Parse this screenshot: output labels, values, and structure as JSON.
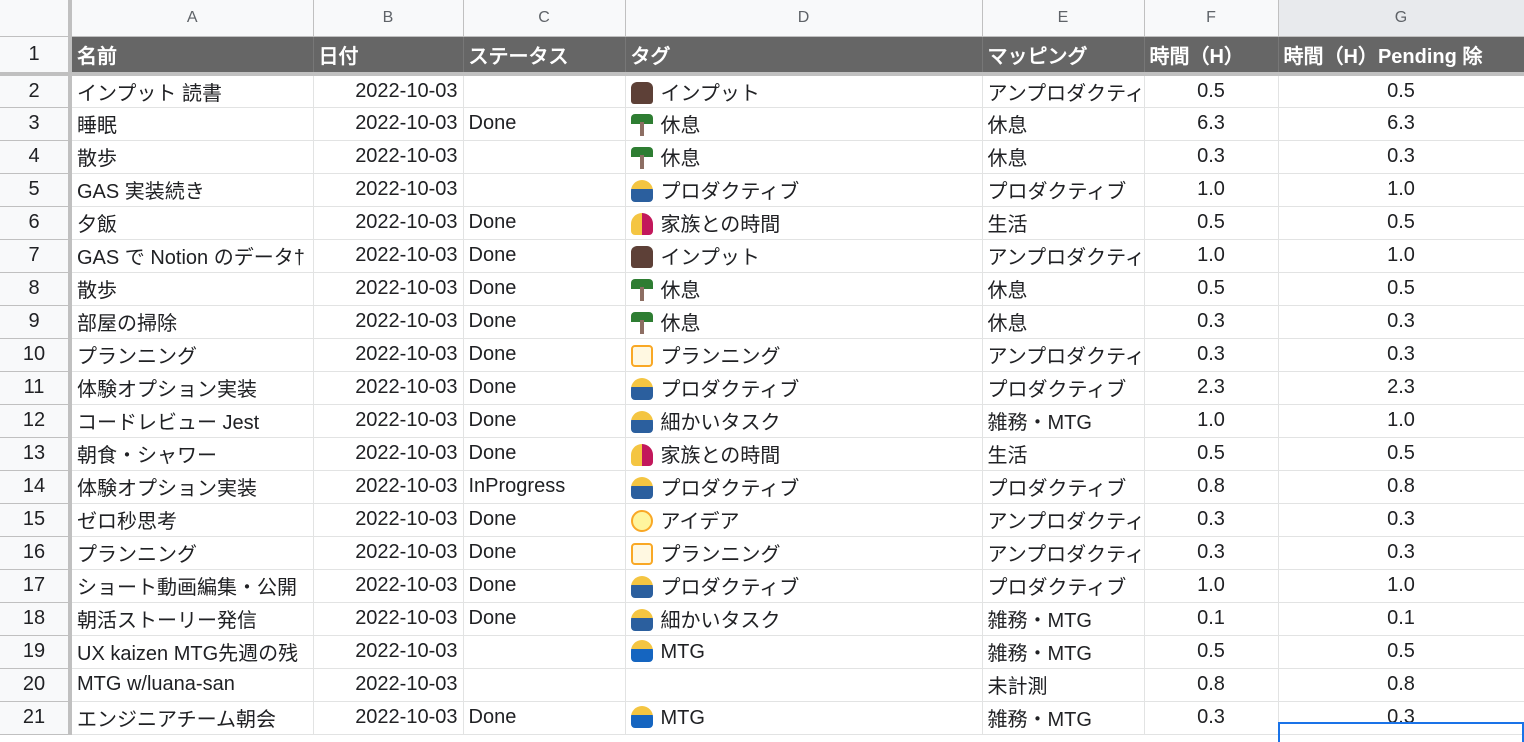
{
  "columns": [
    "A",
    "B",
    "C",
    "D",
    "E",
    "F",
    "G"
  ],
  "header": {
    "row_number": "1",
    "cells": [
      "名前",
      "日付",
      "ステータス",
      "タグ",
      "マッピング",
      "時間（H）",
      "時間（H）Pending 除"
    ]
  },
  "rows": [
    {
      "n": "2",
      "name": "インプット 読書",
      "date": "2022-10-03",
      "status": "",
      "tag": "インプット",
      "tag_icon": "elephant-icon",
      "mapping": "アンプロダクティブ",
      "hours": "0.5",
      "hours_excl": "0.5"
    },
    {
      "n": "3",
      "name": "睡眠",
      "date": "2022-10-03",
      "status": "Done",
      "tag": "休息",
      "tag_icon": "palm-tree-icon",
      "mapping": "休息",
      "hours": "6.3",
      "hours_excl": "6.3"
    },
    {
      "n": "4",
      "name": "散歩",
      "date": "2022-10-03",
      "status": "",
      "tag": "休息",
      "tag_icon": "palm-tree-icon",
      "mapping": "休息",
      "hours": "0.3",
      "hours_excl": "0.3"
    },
    {
      "n": "5",
      "name": "GAS 実装続き",
      "date": "2022-10-03",
      "status": "",
      "tag": "プロダクティブ",
      "tag_icon": "technologist-icon",
      "mapping": "プロダクティブ",
      "hours": "1.0",
      "hours_excl": "1.0"
    },
    {
      "n": "6",
      "name": "夕飯",
      "date": "2022-10-03",
      "status": "Done",
      "tag": "家族との時間",
      "tag_icon": "family-icon",
      "mapping": "生活",
      "hours": "0.5",
      "hours_excl": "0.5"
    },
    {
      "n": "7",
      "name": "GAS で Notion のデータ†",
      "date": "2022-10-03",
      "status": "Done",
      "tag": "インプット",
      "tag_icon": "elephant-icon",
      "mapping": "アンプロダクティブ",
      "hours": "1.0",
      "hours_excl": "1.0"
    },
    {
      "n": "8",
      "name": "散歩",
      "date": "2022-10-03",
      "status": "Done",
      "tag": "休息",
      "tag_icon": "palm-tree-icon",
      "mapping": "休息",
      "hours": "0.5",
      "hours_excl": "0.5"
    },
    {
      "n": "9",
      "name": "部屋の掃除",
      "date": "2022-10-03",
      "status": "Done",
      "tag": "休息",
      "tag_icon": "palm-tree-icon",
      "mapping": "休息",
      "hours": "0.3",
      "hours_excl": "0.3"
    },
    {
      "n": "10",
      "name": "プランニング",
      "date": "2022-10-03",
      "status": "Done",
      "tag": "プランニング",
      "tag_icon": "memo-icon",
      "mapping": "アンプロダクティブ",
      "hours": "0.3",
      "hours_excl": "0.3"
    },
    {
      "n": "11",
      "name": "体験オプション実装",
      "date": "2022-10-03",
      "status": "Done",
      "tag": "プロダクティブ",
      "tag_icon": "technologist-icon",
      "mapping": "プロダクティブ",
      "hours": "2.3",
      "hours_excl": "2.3"
    },
    {
      "n": "12",
      "name": "コードレビュー Jest",
      "date": "2022-10-03",
      "status": "Done",
      "tag": "細かいタスク",
      "tag_icon": "technologist-icon",
      "mapping": "雑務・MTG",
      "hours": "1.0",
      "hours_excl": "1.0"
    },
    {
      "n": "13",
      "name": "朝食・シャワー",
      "date": "2022-10-03",
      "status": "Done",
      "tag": "家族との時間",
      "tag_icon": "family-icon",
      "mapping": "生活",
      "hours": "0.5",
      "hours_excl": "0.5"
    },
    {
      "n": "14",
      "name": "体験オプション実装",
      "date": "2022-10-03",
      "status": "InProgress",
      "tag": "プロダクティブ",
      "tag_icon": "technologist-icon",
      "mapping": "プロダクティブ",
      "hours": "0.8",
      "hours_excl": "0.8"
    },
    {
      "n": "15",
      "name": "ゼロ秒思考",
      "date": "2022-10-03",
      "status": "Done",
      "tag": "アイデア",
      "tag_icon": "lightbulb-icon",
      "mapping": "アンプロダクティブ",
      "hours": "0.3",
      "hours_excl": "0.3"
    },
    {
      "n": "16",
      "name": "プランニング",
      "date": "2022-10-03",
      "status": "Done",
      "tag": "プランニング",
      "tag_icon": "memo-icon",
      "mapping": "アンプロダクティブ",
      "hours": "0.3",
      "hours_excl": "0.3"
    },
    {
      "n": "17",
      "name": "ショート動画編集・公開",
      "date": "2022-10-03",
      "status": "Done",
      "tag": "プロダクティブ",
      "tag_icon": "technologist-icon",
      "mapping": "プロダクティブ",
      "hours": "1.0",
      "hours_excl": "1.0"
    },
    {
      "n": "18",
      "name": "朝活ストーリー発信",
      "date": "2022-10-03",
      "status": "Done",
      "tag": "細かいタスク",
      "tag_icon": "technologist-icon",
      "mapping": "雑務・MTG",
      "hours": "0.1",
      "hours_excl": "0.1"
    },
    {
      "n": "19",
      "name": "UX kaizen MTG先週の残",
      "date": "2022-10-03",
      "status": "",
      "tag": "MTG",
      "tag_icon": "office-worker-icon",
      "mapping": "雑務・MTG",
      "hours": "0.5",
      "hours_excl": "0.5"
    },
    {
      "n": "20",
      "name": "MTG w/luana-san",
      "date": "2022-10-03",
      "status": "",
      "tag": "",
      "tag_icon": "",
      "mapping": "未計測",
      "hours": "0.8",
      "hours_excl": "0.8"
    },
    {
      "n": "21",
      "name": "エンジニアチーム朝会",
      "date": "2022-10-03",
      "status": "Done",
      "tag": "MTG",
      "tag_icon": "office-worker-icon",
      "mapping": "雑務・MTG",
      "hours": "0.3",
      "hours_excl": "0.3"
    }
  ],
  "icon_classes": {
    "elephant-icon": "icon-input",
    "palm-tree-icon": "icon-rest",
    "technologist-icon": "icon-prod",
    "family-icon": "icon-family",
    "memo-icon": "icon-plan",
    "lightbulb-icon": "icon-idea",
    "office-worker-icon": "icon-mtg"
  },
  "colors": {
    "header_bg": "#666666",
    "header_text": "#ffffff",
    "selection": "#1a73e8"
  }
}
